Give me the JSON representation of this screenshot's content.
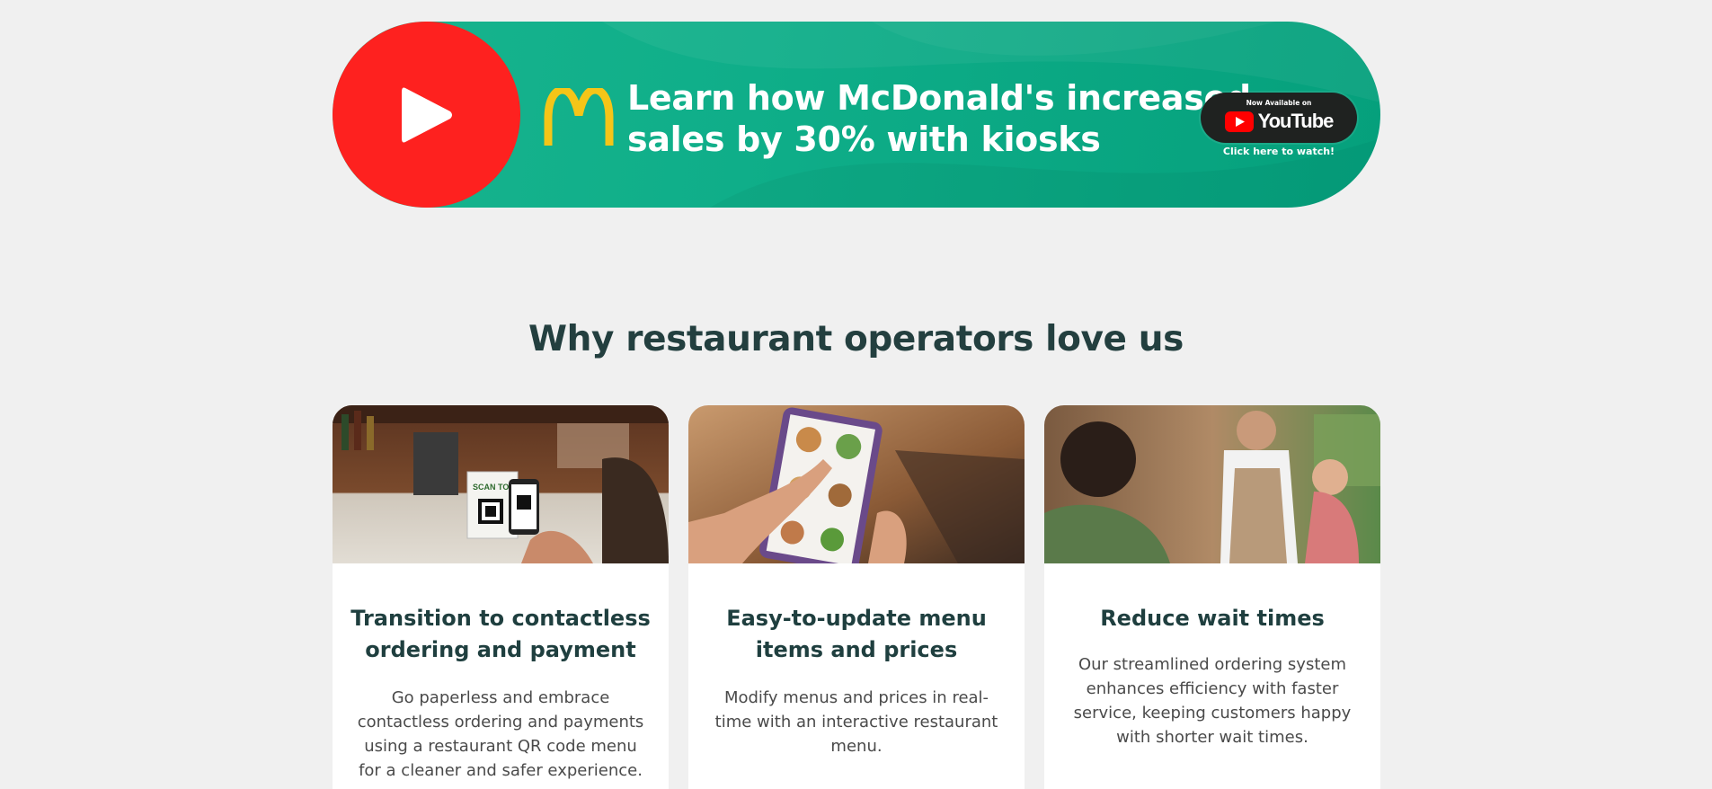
{
  "banner": {
    "headline_line1": "Learn how McDonald's increased",
    "headline_line2": "sales by 30% with kiosks",
    "youtube_available": "Now Available on",
    "youtube_word": "YouTube",
    "youtube_cta": "Click here to watch!",
    "colors": {
      "banner_green": "#0fae89",
      "play_red": "#fe211f",
      "arches_yellow": "#f5c518"
    }
  },
  "section": {
    "title": "Why restaurant operators love us"
  },
  "cards": [
    {
      "image": "qr-code-ordering-photo",
      "title": "Transition to contactless ordering and payment",
      "text": "Go paperless and embrace contactless ordering and payments using a restaurant QR code menu for a cleaner and safer experience."
    },
    {
      "image": "tablet-menu-photo",
      "title": "Easy-to-update menu items and prices",
      "text": "Modify menus and prices in real-time with an interactive restaurant menu."
    },
    {
      "image": "waiter-serving-photo",
      "title": "Reduce wait times",
      "text": "Our streamlined ordering system enhances efficiency with faster service, keeping customers happy with shorter wait times."
    }
  ]
}
